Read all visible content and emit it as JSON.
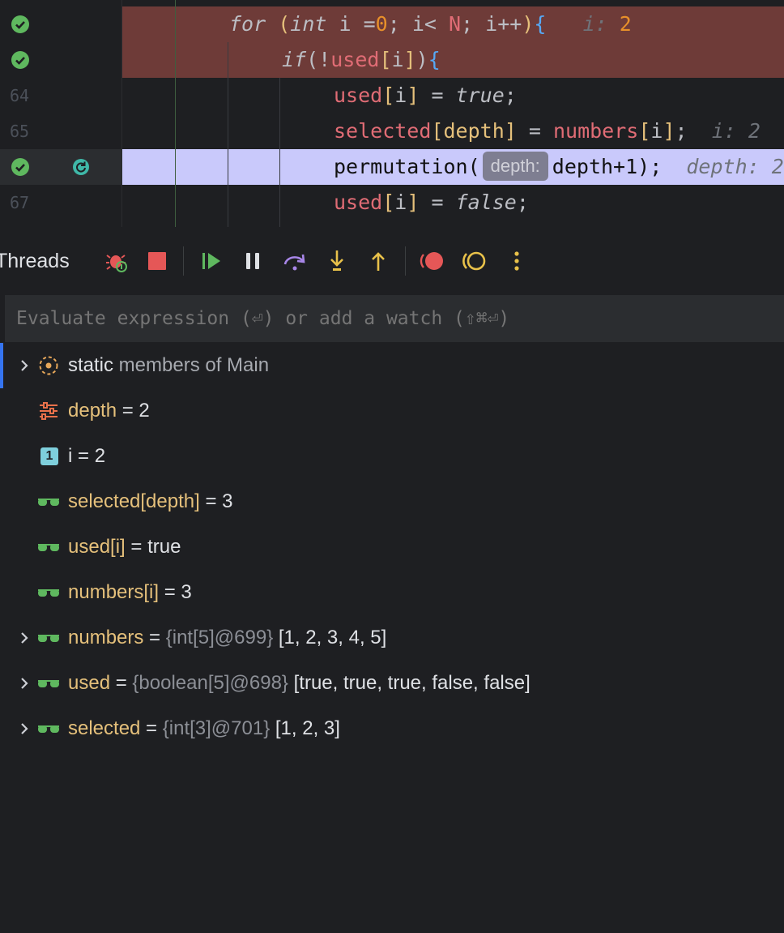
{
  "editor": {
    "lines": [
      {
        "number": "",
        "breakpoint": true
      },
      {
        "number": "",
        "breakpoint": true
      },
      {
        "number": "64",
        "breakpoint": false
      },
      {
        "number": "65",
        "breakpoint": false
      },
      {
        "number": "",
        "breakpoint": true,
        "current": true
      },
      {
        "number": "67",
        "breakpoint": false
      }
    ],
    "line1": {
      "kw_for": "for",
      "open": "(",
      "kw_int": "int",
      "mid": " i =",
      "zero": "0",
      "semi1": "; i< ",
      "N": "N",
      "semi2": "; i++",
      "close": ")",
      "brace": "{",
      "inlay_label": "i:",
      "inlay_value": "2"
    },
    "line2": {
      "kw_if": "if",
      "open": "(",
      "bang": "!",
      "used": "used",
      "lb": "[",
      "i": "i",
      "rb": "]",
      "close": ")",
      "brace": "{"
    },
    "line3": {
      "used": "used",
      "lb": "[",
      "i": "i",
      "rb": "]",
      "eq": " = ",
      "val": "true",
      "semi": ";"
    },
    "line4": {
      "selected": "selected",
      "lb": "[",
      "depth": "depth",
      "rb": "]",
      "eq": " = ",
      "numbers": "numbers",
      "lb2": "[",
      "i": "i",
      "rb2": "]",
      "semi": ";",
      "inlay": "i: 2"
    },
    "line5": {
      "call": "permutation(",
      "tag": "depth:",
      "arg": "depth+1);",
      "inlay": "depth: 2"
    },
    "line6": {
      "used": "used",
      "lb": "[",
      "i": "i",
      "rb": "]",
      "eq": " = ",
      "val": "false",
      "semi": ";"
    }
  },
  "toolbar": {
    "title": "Threads",
    "buttons": [
      "debug-settings",
      "stop",
      "resume",
      "pause",
      "step-over",
      "step-into",
      "step-out",
      "view-breakpoints",
      "mute-breakpoints",
      "more"
    ]
  },
  "evaluate": {
    "placeholder": "Evaluate expression (⏎) or add a watch (⇧⌘⏎)"
  },
  "variables": [
    {
      "label_strong": "static",
      "label_rest": " members of Main"
    },
    {
      "name": "depth",
      "eq": " = ",
      "value": "2"
    },
    {
      "name": "i",
      "eq": " = ",
      "value": "2"
    },
    {
      "name": "selected[depth]",
      "eq": " = ",
      "value": "3"
    },
    {
      "name": "used[i]",
      "eq": " = ",
      "value": "true"
    },
    {
      "name": "numbers[i]",
      "eq": " = ",
      "value": "3"
    },
    {
      "name": "numbers",
      "eq": " = ",
      "type": "{int[5]@699}",
      "value": " [1, 2, 3, 4, 5]"
    },
    {
      "name": "used",
      "eq": " = ",
      "type": "{boolean[5]@698}",
      "value": " [true, true, true, false, false]"
    },
    {
      "name": "selected",
      "eq": " = ",
      "type": "{int[3]@701}",
      "value": " [1, 2, 3]"
    }
  ],
  "colors": {
    "accent": "#3574f0",
    "breakpoint_hit": "#5fb85f",
    "stop": "#e55757",
    "highlight_line": "#c9c9fb",
    "error_line": "#6e3b38"
  }
}
